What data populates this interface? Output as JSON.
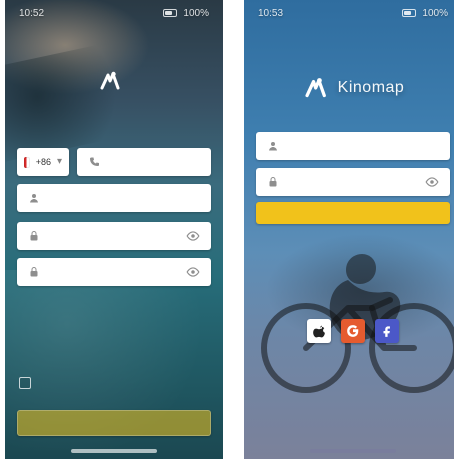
{
  "screens": {
    "left": {
      "status": {
        "time": "10:52",
        "carrier": "",
        "battery": "100%"
      },
      "brand": {
        "name": ""
      },
      "subtitle": "",
      "register": {
        "country_code": "+86",
        "phone_placeholder": "",
        "name_placeholder": "",
        "password_placeholder": "",
        "confirm_password_placeholder": ""
      },
      "agreement": "",
      "cta_label": ""
    },
    "right": {
      "status": {
        "time": "10:53",
        "carrier": "",
        "battery": "100%"
      },
      "brand": {
        "name": "Kinomap"
      },
      "login": {
        "username_placeholder": "",
        "password_placeholder": "",
        "forgot_label": "",
        "login_button": ""
      },
      "social": [
        {
          "name": "apple",
          "label": ""
        },
        {
          "name": "google",
          "label": ""
        },
        {
          "name": "facebook",
          "label": ""
        }
      ],
      "bottom_link": ""
    }
  },
  "colors": {
    "accent": "#f1c21b",
    "google": "#e55b2f",
    "facebook": "#4b58c8"
  }
}
